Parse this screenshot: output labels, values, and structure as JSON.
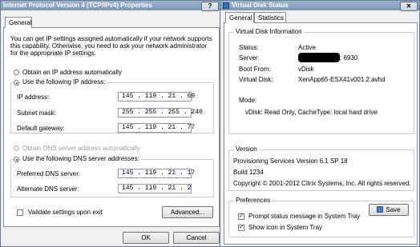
{
  "ipv4": {
    "title": "Internet Protocol Version 4 (TCP/IPv4) Properties",
    "help": "?",
    "tab": "General",
    "intro_line1": "You can get IP settings assigned automatically if your network supports",
    "intro_line2": "this capability. Otherwise, you need to ask your network administrator",
    "intro_line3": "for the appropriate IP settings.",
    "obtain_ip_auto": "Obtain an IP address automatically",
    "use_ip": "Use the following IP address:",
    "ip_label": "IP address:",
    "ip_value": "145 . 119 . 21 . 69",
    "subnet_label": "Subnet mask:",
    "subnet_value": "255 . 255 . 255 . 240",
    "gateway_label": "Default gateway:",
    "gateway_value": "145 . 119 . 21 . 77",
    "obtain_dns_auto": "Obtain DNS server address automatically",
    "use_dns": "Use the following DNS server addresses:",
    "pref_dns_label": "Preferred DNS server:",
    "pref_dns_value": "145 . 119 . 21 . 17",
    "alt_dns_label": "Alternate DNS server:",
    "alt_dns_value": "145 . 119 . 21 . 2",
    "validate_label": "Validate settings upon exit",
    "advanced": "Advanced...",
    "ok": "OK",
    "cancel": "Cancel"
  },
  "vdisk": {
    "title": "Virtual Disk Status",
    "close": "✕",
    "tab_general": "General",
    "tab_statistics": "Statistics",
    "info_group": "Virtual Disk Information",
    "status_label": "Status:",
    "status_value": "Active",
    "server_label": "Server:",
    "server_value": ": 6930",
    "boot_label": "Boot From:",
    "boot_value": "vDisk",
    "vdisk_label": "Virtual Disk:",
    "vdisk_value": "XenApp65-ESX41v001.2.avhd",
    "mode_label": "Mode:",
    "mode_value": "vDisk: Read Only, CacheType: local hard drive",
    "version_group": "Version",
    "version_line": "Provisioning Services Version 6.1 SP 18",
    "build_line": "Build 1234",
    "copyright_line": "Copyright © 2001-2012 Citrix Systems, Inc. All rights reserved.",
    "prefs_group": "Preferences",
    "prompt_label": "Prompt status message in System Tray",
    "show_icon_label": "Show icon in System Tray",
    "save": "Save"
  }
}
